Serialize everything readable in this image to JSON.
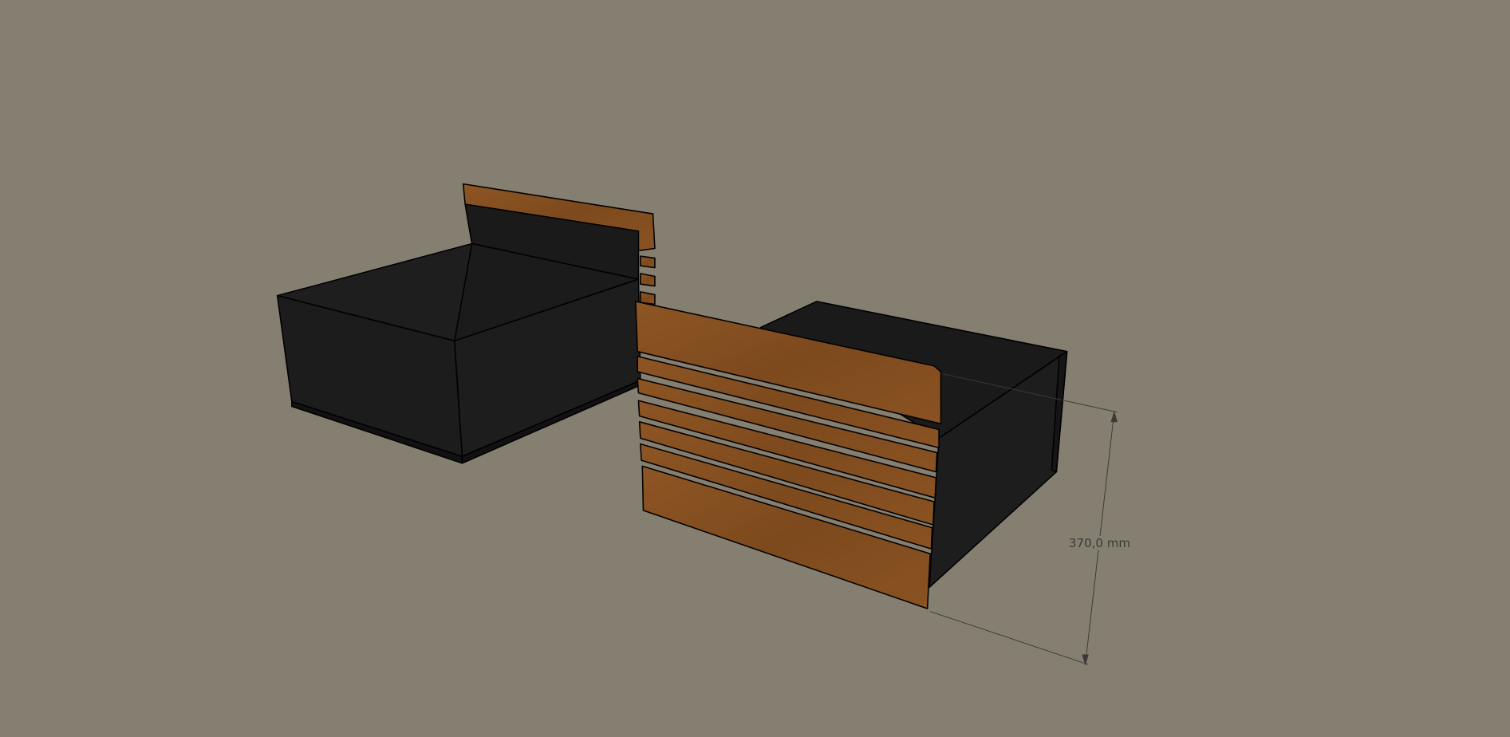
{
  "viewport": {
    "background_color": "#857f72",
    "dimension": {
      "label": "370,0 mm",
      "value_mm": 370.0
    },
    "colors": {
      "carcass": "#1c1c1c",
      "wood": "#87501f",
      "edge": "#000000"
    }
  }
}
